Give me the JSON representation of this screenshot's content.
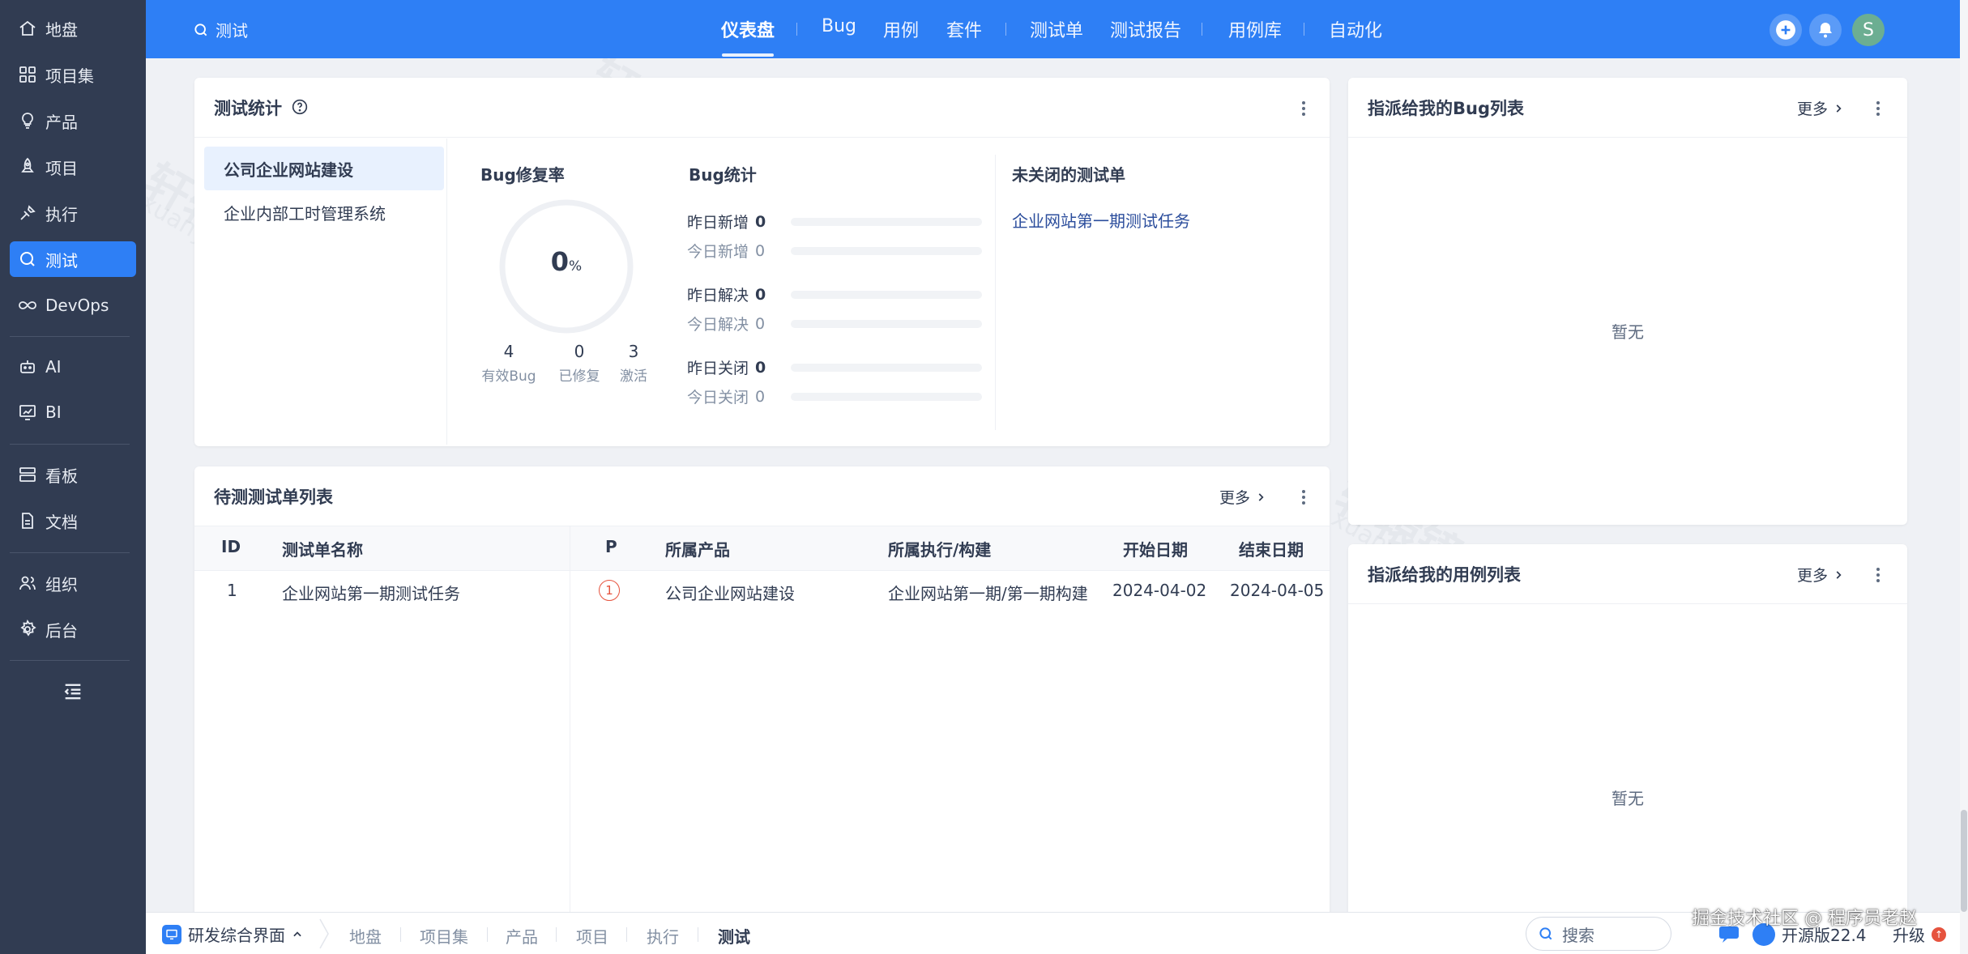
{
  "sidebar": {
    "items": [
      {
        "label": "地盘",
        "icon": "home-icon"
      },
      {
        "label": "项目集",
        "icon": "grid-icon"
      },
      {
        "label": "产品",
        "icon": "bulb-icon"
      },
      {
        "label": "项目",
        "icon": "rocket-icon"
      },
      {
        "label": "执行",
        "icon": "run-icon"
      },
      {
        "label": "测试",
        "icon": "search-icon"
      },
      {
        "label": "DevOps",
        "icon": "infinity-icon"
      },
      {
        "label": "AI",
        "icon": "robot-icon"
      },
      {
        "label": "BI",
        "icon": "chart-icon"
      },
      {
        "label": "看板",
        "icon": "board-icon"
      },
      {
        "label": "文档",
        "icon": "doc-icon"
      },
      {
        "label": "组织",
        "icon": "people-icon"
      },
      {
        "label": "后台",
        "icon": "gear-icon"
      }
    ],
    "active": "测试"
  },
  "header": {
    "search_label": "测试",
    "tabs": [
      "仪表盘",
      "Bug",
      "用例",
      "套件",
      "测试单",
      "测试报告",
      "用例库",
      "自动化"
    ],
    "active_tab": "仪表盘",
    "avatar_letter": "S"
  },
  "stats_card": {
    "title": "测试统计",
    "products": [
      "公司企业网站建设",
      "企业内部工时管理系统"
    ],
    "fix_rate_title": "Bug修复率",
    "fix_rate_value": "0",
    "fix_rate_unit": "%",
    "mini": [
      {
        "num": "4",
        "label": "有效Bug"
      },
      {
        "num": "0",
        "label": "已修复"
      },
      {
        "num": "3",
        "label": "激活"
      }
    ],
    "bug_stats_title": "Bug统计",
    "bug_stats": [
      {
        "label": "昨日新增",
        "value": "0"
      },
      {
        "label": "今日新增",
        "value": "0"
      },
      {
        "label": "昨日解决",
        "value": "0"
      },
      {
        "label": "今日解决",
        "value": "0"
      },
      {
        "label": "昨日关闭",
        "value": "0"
      },
      {
        "label": "今日关闭",
        "value": "0"
      }
    ],
    "open_testtasks_title": "未关闭的测试单",
    "open_testtasks": [
      "企业网站第一期测试任务"
    ]
  },
  "pending_card": {
    "title": "待测测试单列表",
    "more": "更多",
    "columns": [
      "ID",
      "测试单名称",
      "P",
      "所属产品",
      "所属执行/构建",
      "开始日期",
      "结束日期"
    ],
    "rows": [
      {
        "id": "1",
        "name": "企业网站第一期测试任务",
        "pri": "1",
        "product": "公司企业网站建设",
        "execution": "企业网站第一期/第一期构建",
        "start": "2024-04-02",
        "end": "2024-04-05"
      }
    ]
  },
  "bug_card": {
    "title": "指派给我的Bug列表",
    "more": "更多",
    "empty": "暂无"
  },
  "case_card": {
    "title": "指派给我的用例列表",
    "more": "更多",
    "empty": "暂无"
  },
  "bottombar": {
    "workspace": "研发综合界面",
    "items": [
      "地盘",
      "项目集",
      "产品",
      "项目",
      "执行",
      "测试"
    ],
    "active": "测试",
    "search_placeholder": "搜索",
    "version": "开源版22.4",
    "upgrade": "升级",
    "upgrade_badge": "↑"
  },
  "watermark": {
    "text": "轩辕镜像",
    "sub": "xuanyuan.cloud"
  },
  "credit": "掘金技术社区 @ 程序员老赵",
  "colors": {
    "primary": "#2e7ff5",
    "sidebar": "#313c52",
    "danger": "#e6533e",
    "link": "#2b4d9c"
  }
}
